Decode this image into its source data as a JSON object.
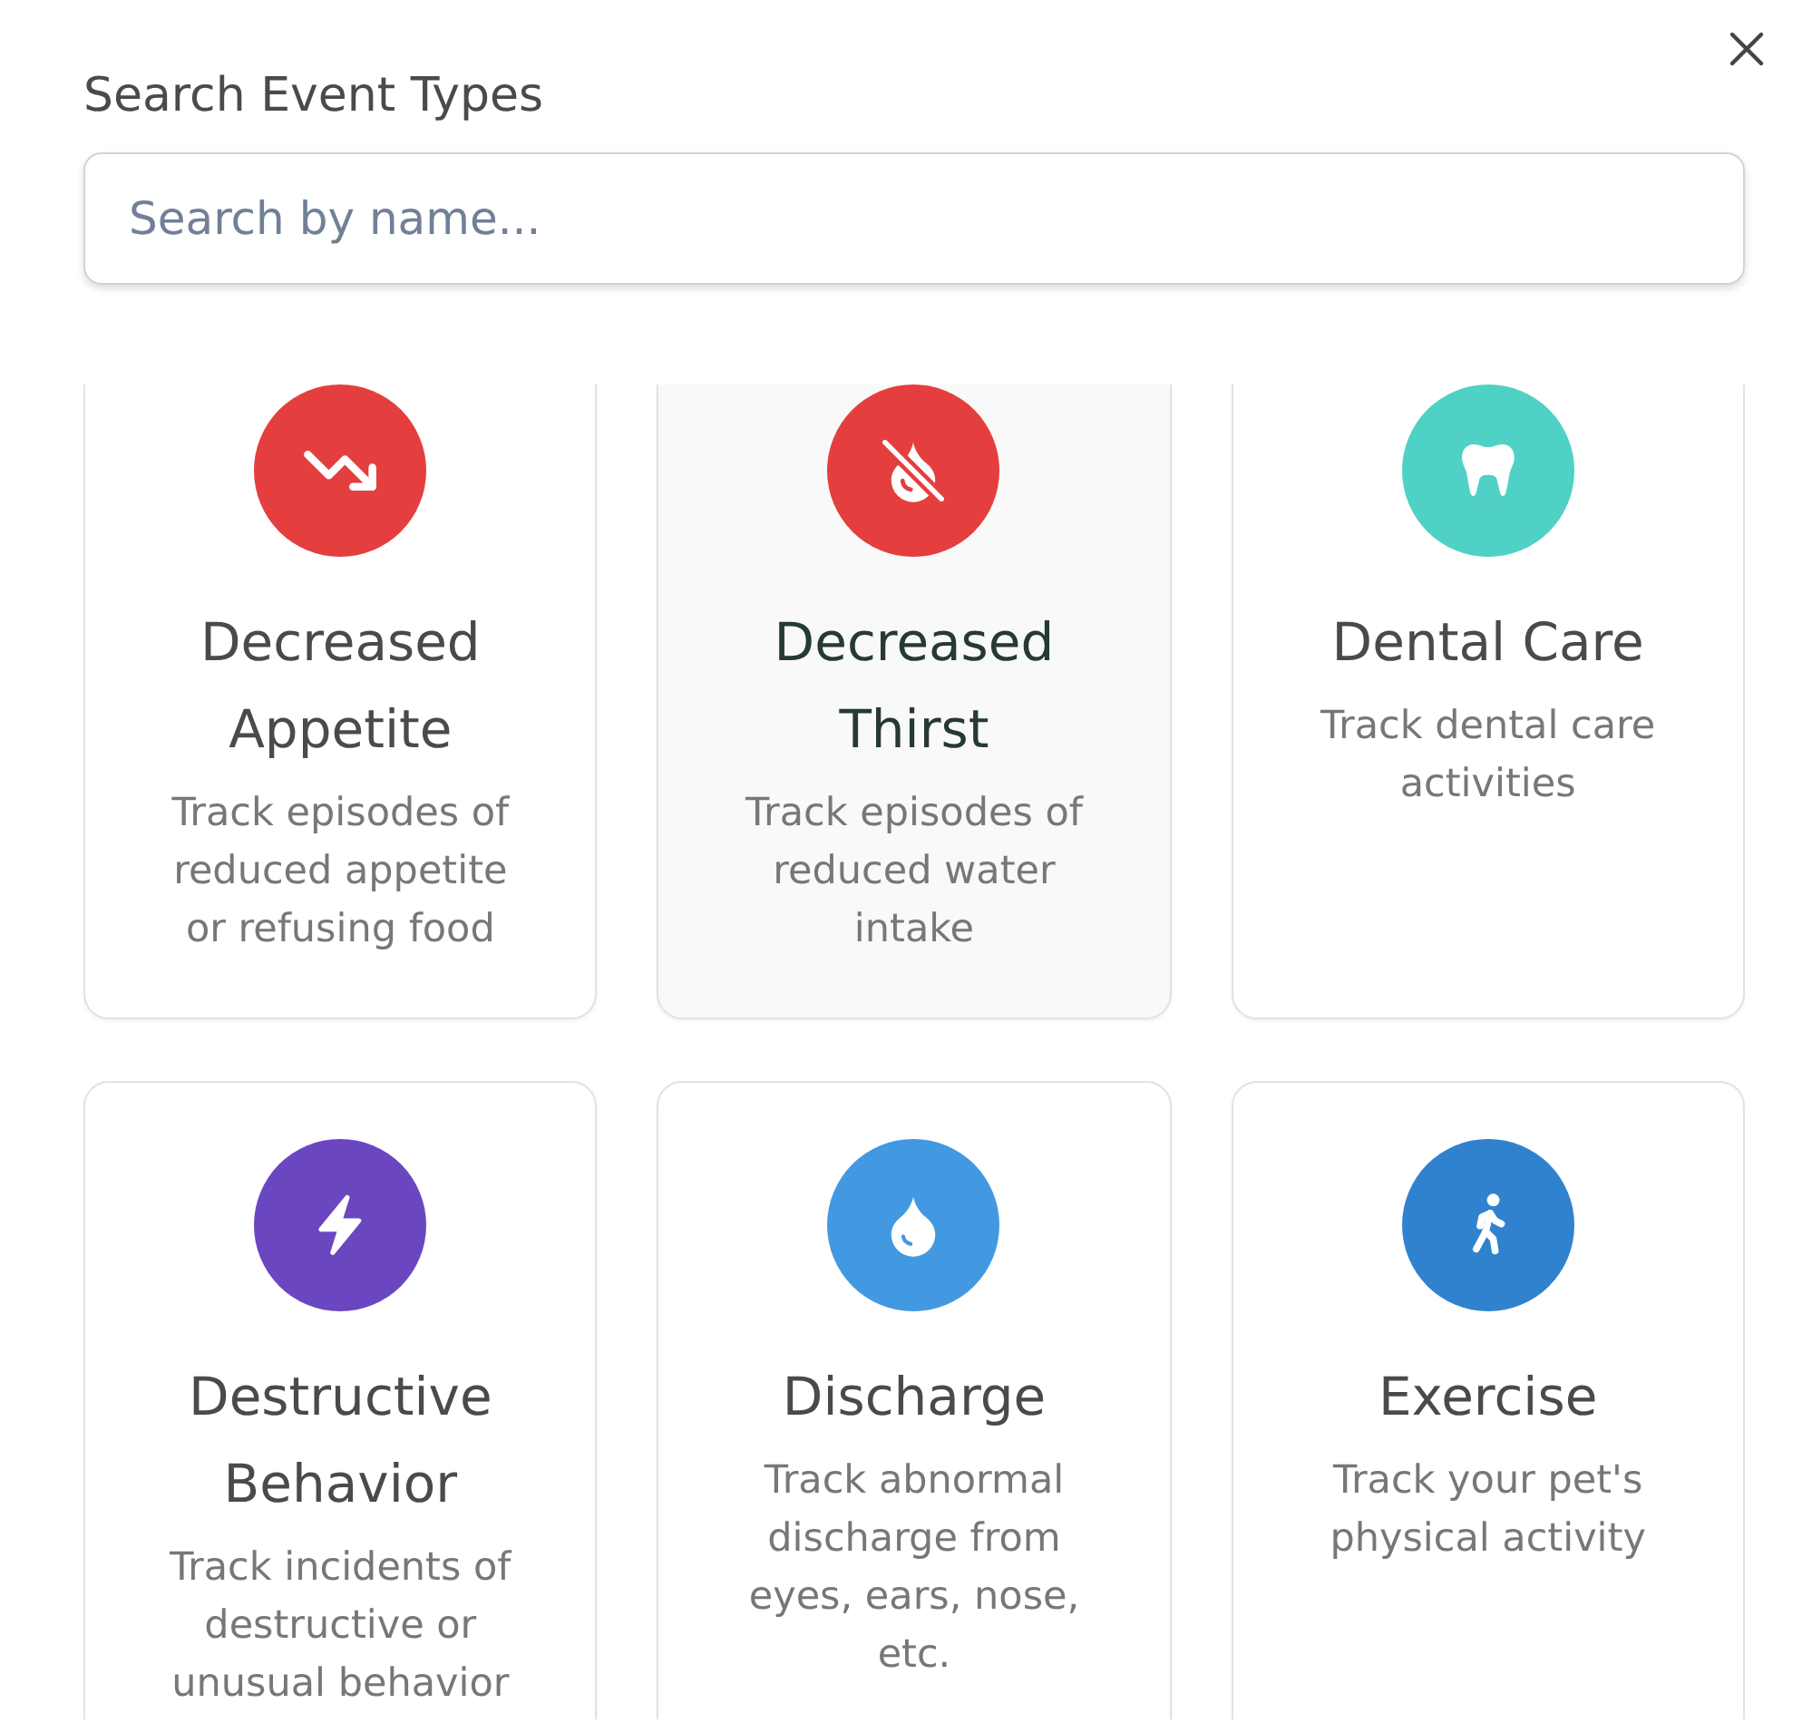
{
  "dialog": {
    "title": "Search Event Types"
  },
  "search": {
    "placeholder": "Search by name..."
  },
  "event_types": [
    {
      "name": "Decreased Appetite",
      "description": "Track episodes of reduced appetite or refusing food",
      "color": "#e53e3e",
      "highlighted": false
    },
    {
      "name": "Decreased Thirst",
      "description": "Track episodes of reduced water intake",
      "color": "#e53e3e",
      "highlighted": true
    },
    {
      "name": "Dental Care",
      "description": "Track dental care activities",
      "color": "#4fd1c5",
      "highlighted": false
    },
    {
      "name": "Destructive Behavior",
      "description": "Track incidents of destructive or unusual behavior",
      "color": "#6b46c1",
      "highlighted": false
    },
    {
      "name": "Discharge",
      "description": "Track abnormal discharge from eyes, ears, nose, etc.",
      "color": "#4299e1",
      "highlighted": false
    },
    {
      "name": "Exercise",
      "description": "Track your pet's physical activity",
      "color": "#3182ce",
      "highlighted": false
    }
  ]
}
